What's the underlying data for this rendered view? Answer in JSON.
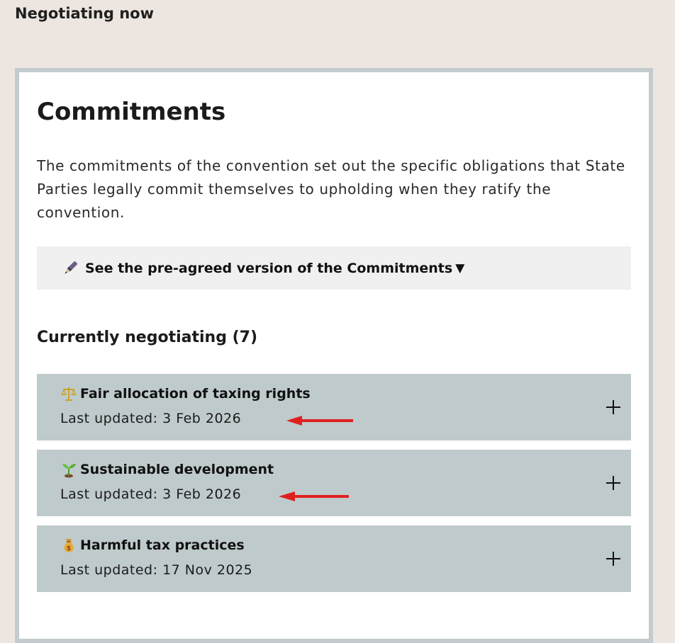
{
  "page": {
    "heading": "Negotiating now"
  },
  "card": {
    "title": "Commitments",
    "description": "The commitments of the convention set out the specific obligations that State Parties legally commit themselves to upholding when they ratify the convention.",
    "preagreed": {
      "icon": "pen-icon",
      "label": "See the pre-agreed version of the Commitments",
      "caret": "▼"
    },
    "section_heading": "Currently negotiating (7)",
    "items": [
      {
        "icon": "scales-icon",
        "title": "Fair allocation of taxing rights",
        "updated": "Last updated: 3 Feb 2026",
        "annotated": true
      },
      {
        "icon": "seedling-icon",
        "title": "Sustainable development",
        "updated": "Last updated: 3 Feb 2026",
        "annotated": true
      },
      {
        "icon": "money-bag-icon",
        "title": "Harmful tax practices",
        "updated": "Last updated: 17 Nov 2025",
        "annotated": false
      }
    ]
  },
  "colors": {
    "page_bg": "#ede6e0",
    "card_border": "#c2cccf",
    "accordion_bg": "#bfcacc",
    "preagreed_bg": "#f0f0f0",
    "annotation_arrow": "#e0201e"
  }
}
